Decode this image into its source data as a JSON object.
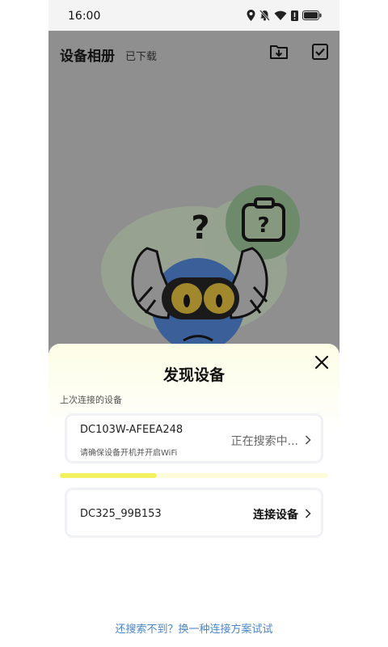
{
  "status_bar": {
    "time": "16:00",
    "icons": [
      "location-icon",
      "bell-muted-icon",
      "wifi-icon",
      "alert-icon",
      "battery-icon"
    ]
  },
  "app_bar": {
    "title": "设备相册",
    "subtitle": "已下载",
    "actions": [
      "folder-download-icon",
      "select-checkbox-icon"
    ]
  },
  "sheet": {
    "title": "发现设备",
    "section_label": "上次连接的设备",
    "last_device": {
      "name": "DC103W-AFEEA248",
      "hint": "请确保设备开机并开启WiFi",
      "status": "正在搜索中..."
    },
    "search_progress": 0.36,
    "found_device": {
      "name": "DC325_99B153",
      "action": "连接设备"
    },
    "help_link": "还搜索不到？换一种连接方案试试"
  },
  "colors": {
    "overlay": "#8f8f8f",
    "sheet_top": "#fdfde7",
    "progress": "#f2f260",
    "link": "#4a86c8"
  }
}
